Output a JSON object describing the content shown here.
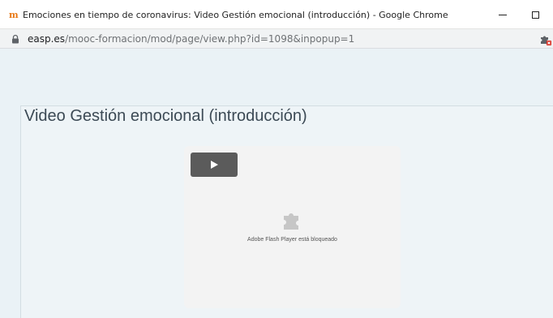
{
  "window": {
    "favicon_glyph": "m",
    "title": "Emociones en tiempo de coronavirus: Video Gestión emocional (introducción) - Google Chrome",
    "minimize_glyph": "—",
    "maximize_glyph": "☐"
  },
  "address_bar": {
    "host": "easp.es",
    "path": "/mooc-formacion/mod/page/view.php?id=1098&inpopup=1",
    "lock_icon": "lock-icon",
    "extension_icon": "puzzle-blocked-icon"
  },
  "page": {
    "heading": "Video Gestión emocional (introducción)",
    "player": {
      "play_icon": "play-icon",
      "plugin_icon": "puzzle-icon",
      "blocked_message": "Adobe Flash Player está bloqueado"
    }
  },
  "colors": {
    "page_background": "#eaf2f6",
    "heading_text": "#3c4a55",
    "player_background": "#f3f3f3",
    "play_button": "#5b5b5b",
    "plugin_icon": "#c6c6c6",
    "favicon": "#e87a18"
  }
}
